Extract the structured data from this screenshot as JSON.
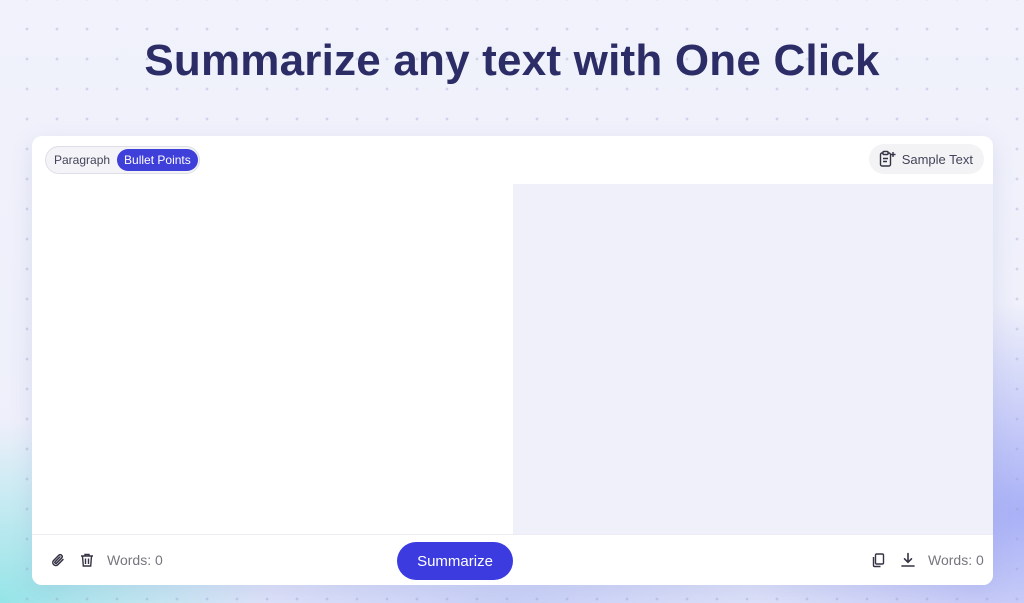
{
  "header": {
    "title": "Summarize any text with One Click"
  },
  "mode_toggle": {
    "options": [
      "Paragraph",
      "Bullet Points"
    ],
    "selected": "Bullet Points"
  },
  "sample_text_button": {
    "label": "Sample Text",
    "icon": "clipboard-plus-icon"
  },
  "footer": {
    "attach_icon": "paperclip-icon",
    "delete_icon": "trash-icon",
    "input_words": "Words: 0",
    "summarize_label": "Summarize",
    "copy_icon": "copy-icon",
    "download_icon": "download-icon",
    "output_words": "Words: 0"
  },
  "colors": {
    "accent": "#3b3be0",
    "title": "#2c2c66",
    "output_bg": "#f0f0fb"
  }
}
